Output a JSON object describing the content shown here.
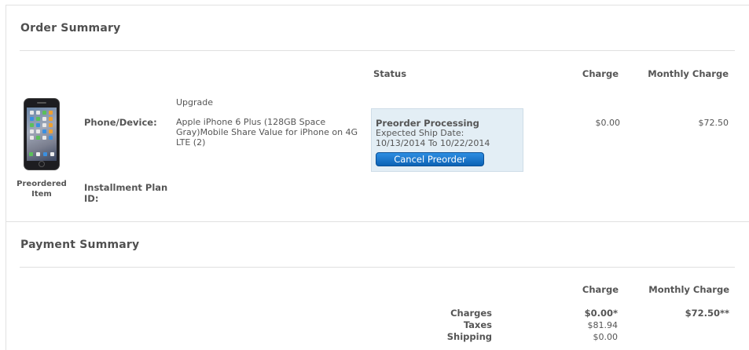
{
  "order_summary": {
    "title": "Order Summary",
    "headers": {
      "status": "Status",
      "charge": "Charge",
      "monthly_charge": "Monthly Charge"
    },
    "item": {
      "image_caption": "Preordered Item",
      "type": "Upgrade",
      "device_label": "Phone/Device:",
      "device_description": "Apple iPhone 6 Plus (128GB Space Gray)Mobile Share Value for iPhone on 4G LTE (2)",
      "installment_label": "Installment Plan ID:",
      "status_title": "Preorder Processing",
      "ship_label": "Expected Ship Date:",
      "ship_dates": "10/13/2014 To 10/22/2014",
      "cancel_button": "Cancel Preorder",
      "charge": "$0.00",
      "monthly_charge": "$72.50"
    }
  },
  "payment_summary": {
    "title": "Payment Summary",
    "headers": {
      "charge": "Charge",
      "monthly_charge": "Monthly Charge"
    },
    "rows": [
      {
        "label": "Charges",
        "charge": "$0.00*",
        "monthly": "$72.50**"
      },
      {
        "label": "Taxes",
        "charge": "$81.94",
        "monthly": ""
      },
      {
        "label": "Shipping",
        "charge": "$0.00",
        "monthly": ""
      }
    ]
  }
}
